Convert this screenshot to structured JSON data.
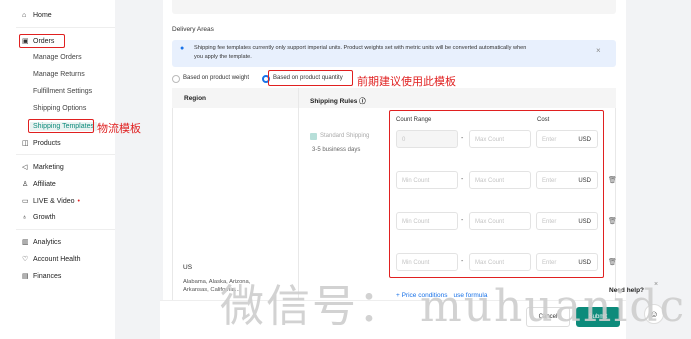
{
  "sidebar": {
    "home": "Home",
    "orders": "Orders",
    "manage_orders": "Manage Orders",
    "manage_returns": "Manage Returns",
    "fulfillment_settings": "Fulfillment Settings",
    "shipping_options": "Shipping Options",
    "shipping_templates": "Shipping Templates",
    "products": "Products",
    "marketing": "Marketing",
    "affiliate": "Affiliate",
    "live_video": "LIVE & Video",
    "growth": "Growth",
    "analytics": "Analytics",
    "account_health": "Account Health",
    "finances": "Finances"
  },
  "annotations": {
    "logistics_template": "物流模板",
    "early_suggestion": "前期建议使用此模板"
  },
  "main": {
    "section_title": "Delivery Areas",
    "info_line1": "Shipping fee templates currently only support imperial units. Product weights set with metric units will be converted automatically when",
    "info_line2": "you apply the template.",
    "radio_weight": "Based on product weight",
    "radio_quantity": "Based on product quantity",
    "col_region": "Region",
    "col_rules": "Shipping Rules ⓘ",
    "standard_shipping": "Standard Shipping",
    "business_days": "3-5 business days",
    "count_range": "Count Range",
    "cost": "Cost",
    "min_count_first": "0",
    "min_count": "Min Count",
    "max_count": "Max Count",
    "enter": "Enter",
    "currency": "USD",
    "region_name": "US",
    "region_states": "Alabama, Alaska, Arizona, Arkansas, California...",
    "price_conditions": "+ Price conditions",
    "use_formula": "use formula"
  },
  "footer": {
    "cancel": "Cancel",
    "submit": "Submit",
    "need_help": "Need help?",
    "close": "×"
  },
  "watermark": "微信号： muhuanidc"
}
